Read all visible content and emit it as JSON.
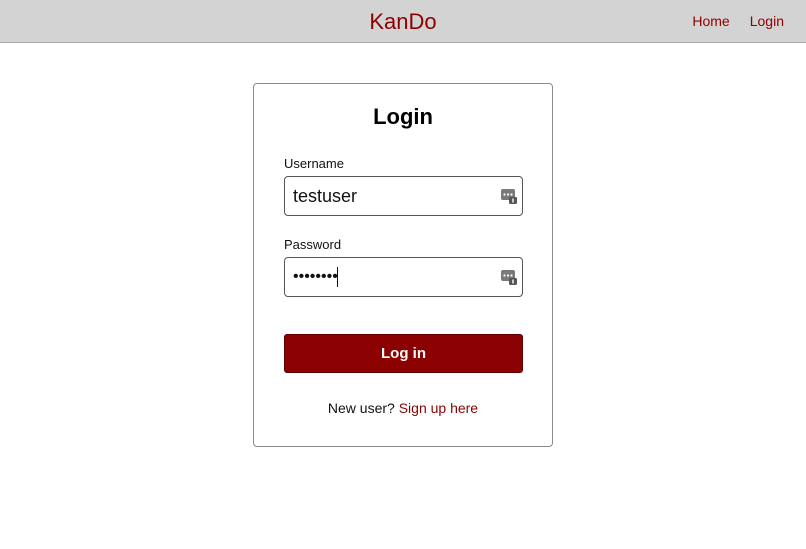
{
  "header": {
    "brand": "KanDo",
    "nav": [
      {
        "label": "Home"
      },
      {
        "label": "Login"
      }
    ]
  },
  "login_form": {
    "title": "Login",
    "username": {
      "label": "Username",
      "value": "testuser",
      "icon": "password-manager-icon"
    },
    "password": {
      "label": "Password",
      "value": "password",
      "icon": "password-manager-icon"
    },
    "submit_label": "Log in",
    "signup_prompt": "New user?",
    "signup_link": "Sign up here"
  },
  "colors": {
    "brand": "#8b0000",
    "header_bg": "#d3d3d3",
    "button_bg": "#8b0000"
  }
}
